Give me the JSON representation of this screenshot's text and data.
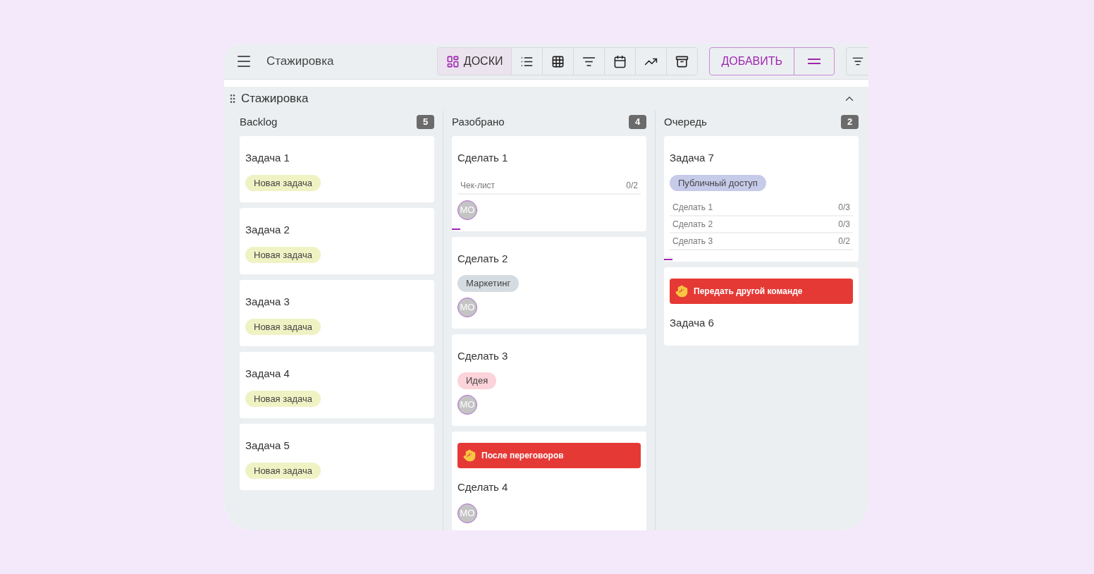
{
  "header": {
    "title": "Стажировка",
    "views": [
      {
        "kind": "boards",
        "label": "ДОСКИ",
        "selected": true
      },
      {
        "kind": "list",
        "selected": false
      },
      {
        "kind": "table",
        "selected": false
      },
      {
        "kind": "sort",
        "selected": false
      },
      {
        "kind": "calendar",
        "selected": false
      },
      {
        "kind": "chart",
        "selected": false
      },
      {
        "kind": "archive",
        "selected": false
      }
    ],
    "add_button": "ДОБАВИТЬ"
  },
  "board": {
    "title": "Стажировка",
    "expanded": true,
    "columns": [
      {
        "name": "Backlog",
        "count": "5",
        "cards": [
          {
            "title": "Задача 1",
            "tags": [
              {
                "text": "Новая задача",
                "color": "#eff3c4"
              }
            ],
            "indicator": false
          },
          {
            "title": "Задача 2",
            "tags": [
              {
                "text": "Новая задача",
                "color": "#eff3c4"
              }
            ],
            "indicator": false
          },
          {
            "title": "Задача 3",
            "tags": [
              {
                "text": "Новая задача",
                "color": "#eff3c4"
              }
            ],
            "indicator": false
          },
          {
            "title": "Задача 4",
            "tags": [
              {
                "text": "Новая задача",
                "color": "#eff3c4"
              }
            ],
            "indicator": false
          },
          {
            "title": "Задача 5",
            "tags": [
              {
                "text": "Новая задача",
                "color": "#eff3c4"
              }
            ],
            "indicator": false
          }
        ]
      },
      {
        "name": "Разобрано",
        "count": "4",
        "cards": [
          {
            "title": "Сделать 1",
            "checklists": [
              {
                "name": "Чек-лист",
                "progress": "0/2"
              }
            ],
            "avatar": "МО",
            "indicator": true
          },
          {
            "title": "Сделать 2",
            "tags": [
              {
                "text": "Маркетинг",
                "color": "#d5dce1"
              }
            ],
            "avatar": "МО",
            "indicator": false
          },
          {
            "title": "Сделать 3",
            "tags": [
              {
                "text": "Идея",
                "color": "#fbd3d9"
              }
            ],
            "avatar": "МО",
            "indicator": false
          },
          {
            "title": "Сделать 4",
            "blocker": "После переговоров",
            "avatar": "МО",
            "indicator": false
          }
        ]
      },
      {
        "name": "Очередь",
        "count": "2",
        "cards": [
          {
            "title": "Задача 7",
            "tags": [
              {
                "text": "Публичный доступ",
                "color": "#c7cbea"
              }
            ],
            "checklists": [
              {
                "name": "Сделать 1",
                "progress": "0/3"
              },
              {
                "name": "Сделать 2",
                "progress": "0/3"
              },
              {
                "name": "Сделать 3",
                "progress": "0/2"
              }
            ],
            "indicator": true
          },
          {
            "title": "Задача 6",
            "blocker": "Передать другой команде",
            "indicator": false
          }
        ]
      }
    ]
  }
}
